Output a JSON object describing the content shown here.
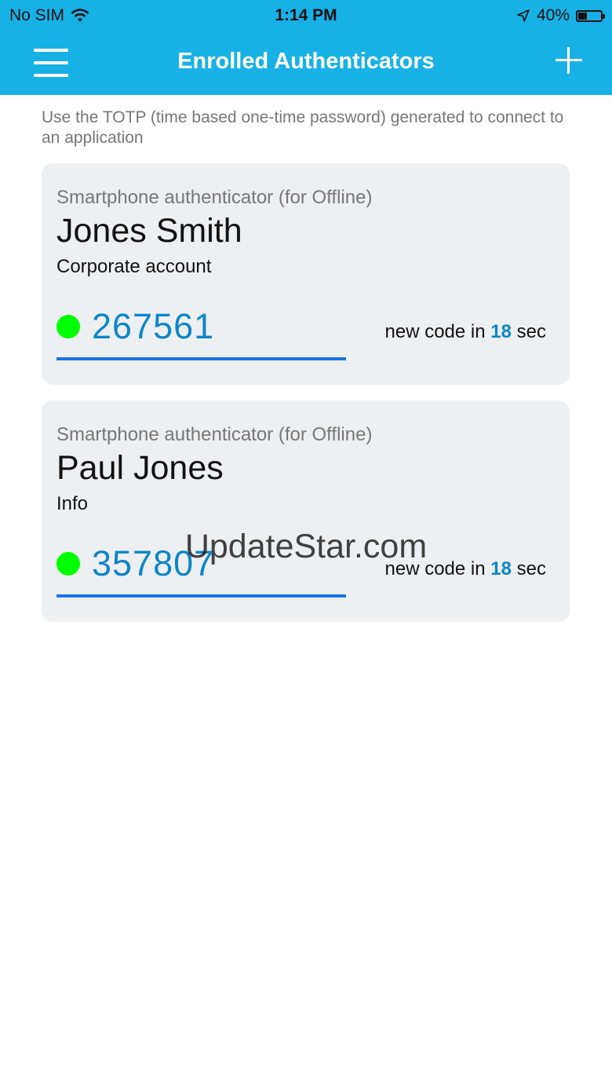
{
  "status_bar": {
    "carrier": "No SIM",
    "time": "1:14 PM",
    "battery_text": "40%",
    "battery_level": 0.4
  },
  "nav": {
    "title": "Enrolled Authenticators"
  },
  "intro": "Use the TOTP (time based one-time password) generated to connect to an application",
  "cards": [
    {
      "type": "Smartphone authenticator (for Offline)",
      "name": "Jones Smith",
      "description": "Corporate account",
      "code": "267561",
      "timer_prefix": "new code in",
      "timer_value": "18",
      "timer_suffix": "sec"
    },
    {
      "type": "Smartphone authenticator (for Offline)",
      "name": "Paul Jones",
      "description": "Info",
      "code": "357807",
      "timer_prefix": "new code in",
      "timer_value": "18",
      "timer_suffix": "sec"
    }
  ],
  "watermark": "UpdateStar.com",
  "colors": {
    "header": "#17b1e6",
    "card_bg": "#edf0f2",
    "code": "#0d86c8",
    "status_dot": "#00ff00",
    "progress": "#1a73e8"
  }
}
